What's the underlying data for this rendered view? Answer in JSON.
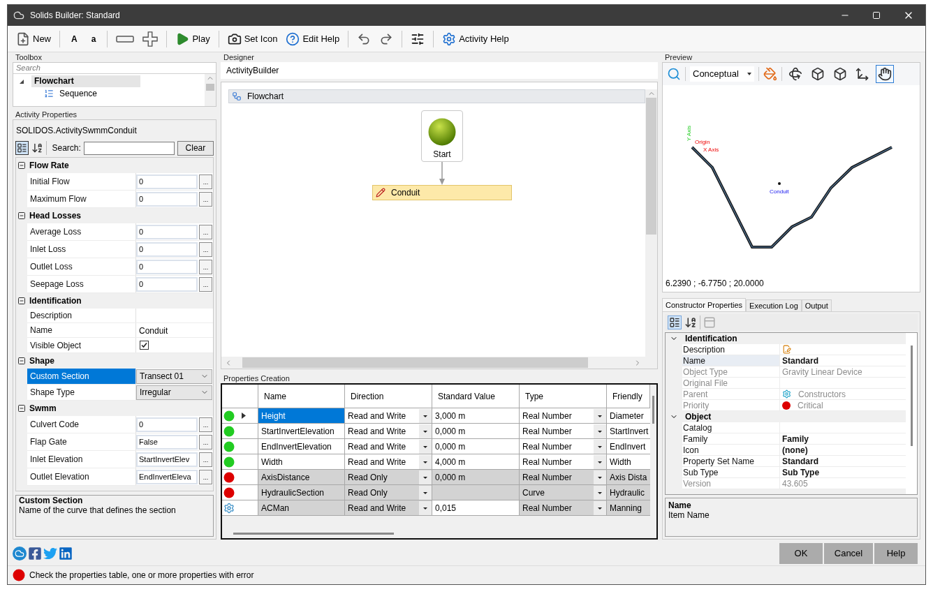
{
  "window": {
    "title": "Solids Builder: Standard"
  },
  "toolbar": [
    {
      "kind": "button",
      "label": "New"
    },
    {
      "kind": "separator"
    },
    {
      "kind": "text",
      "label": "A"
    },
    {
      "kind": "text",
      "label": "a"
    },
    {
      "kind": "separator"
    },
    {
      "kind": "button"
    },
    {
      "kind": "button"
    },
    {
      "kind": "separator"
    },
    {
      "kind": "button",
      "label": "Play"
    },
    {
      "kind": "separator"
    },
    {
      "kind": "button",
      "label": "Set Icon"
    },
    {
      "kind": "button",
      "label": "Edit Help"
    },
    {
      "kind": "separator"
    },
    {
      "kind": "button"
    },
    {
      "kind": "button"
    },
    {
      "kind": "separator"
    },
    {
      "kind": "button"
    },
    {
      "kind": "separator"
    },
    {
      "kind": "button",
      "label": "Activity Help"
    }
  ],
  "toolbox": {
    "title": "Toolbox",
    "search": {
      "placeholder": "Search"
    },
    "tree": [
      {
        "label": "Flowchart",
        "expanded": true,
        "selected": true,
        "children": [
          {
            "label": "Sequence",
            "selected": false
          }
        ]
      }
    ]
  },
  "activity_properties": {
    "title": "Activity Properties",
    "object": "SOLIDOS.ActivitySwmmConduit",
    "search_label": "Search:",
    "clear_button": "Clear",
    "groups": [
      {
        "title": "Flow Rate",
        "expanded": true,
        "rows": [
          {
            "label": "Initial Flow",
            "kind": "field",
            "value": "0",
            "button": "...",
            "selected": false
          },
          {
            "label": "Maximum Flow",
            "kind": "field",
            "value": "0",
            "button": "...",
            "selected": false
          }
        ]
      },
      {
        "title": "Head Losses",
        "expanded": true,
        "rows": [
          {
            "label": "Average Loss",
            "kind": "field",
            "value": "0",
            "button": "...",
            "selected": false
          },
          {
            "label": "Inlet Loss",
            "kind": "field",
            "value": "0",
            "button": "...",
            "selected": false
          },
          {
            "label": "Outlet Loss",
            "kind": "field",
            "value": "0",
            "button": "...",
            "selected": false
          },
          {
            "label": "Seepage Loss",
            "kind": "field",
            "value": "0",
            "button": "...",
            "selected": false
          }
        ]
      },
      {
        "title": "Identification",
        "expanded": true,
        "rows": [
          {
            "label": "Description",
            "kind": "text",
            "selected": false
          },
          {
            "label": "Name",
            "kind": "text",
            "value": "Conduit",
            "selected": false
          },
          {
            "label": "Visible Object",
            "kind": "checkbox",
            "checked": true,
            "selected": false
          }
        ]
      },
      {
        "title": "Shape",
        "expanded": true,
        "rows": [
          {
            "label": "Custom Section",
            "kind": "dropdown",
            "value": "Transect 01",
            "selected": true
          },
          {
            "label": "Shape Type",
            "kind": "dropdown",
            "value": "Irregular",
            "selected": false
          }
        ]
      },
      {
        "title": "Swmm",
        "expanded": true,
        "rows": [
          {
            "label": "Culvert Code",
            "kind": "field",
            "value": "0",
            "button": "...",
            "selected": false
          },
          {
            "label": "Flap Gate",
            "kind": "field",
            "value": "False",
            "button": "...",
            "selected": false
          },
          {
            "label": "Inlet Elevation",
            "kind": "field",
            "value": "StartInvertElev",
            "button": "...",
            "selected": false
          },
          {
            "label": "Outlet Elevation",
            "kind": "field",
            "value": "EndInvertEleva",
            "button": "...",
            "selected": false
          }
        ]
      }
    ],
    "description": {
      "title": "Custom Section",
      "text": "Name of the curve that defines the section"
    }
  },
  "designer": {
    "title": "Designer",
    "breadcrumb": "ActivityBuilder",
    "flowchart": {
      "title": "Flowchart",
      "start": "Start",
      "activity": "Conduit"
    }
  },
  "properties_creation": {
    "title": "Properties Creation",
    "columns": [
      "Name",
      "Direction",
      "Standard Value",
      "Type",
      "Friendly"
    ],
    "rows": [
      {
        "kind": "dot",
        "color": "#22cc22",
        "current": true,
        "selected": true,
        "locked": false,
        "value_locked": false,
        "name": "Height",
        "direction": "Read and Write",
        "value": "3,000 m",
        "type": "Real Number",
        "friendly": "Diameter"
      },
      {
        "kind": "dot",
        "color": "#22cc22",
        "current": false,
        "selected": false,
        "locked": false,
        "value_locked": false,
        "name": "StartInvertElevation",
        "direction": "Read and Write",
        "value": "0,000 m",
        "type": "Real Number",
        "friendly": "StartInvert"
      },
      {
        "kind": "dot",
        "color": "#22cc22",
        "current": false,
        "selected": false,
        "locked": false,
        "value_locked": false,
        "name": "EndInvertElevation",
        "direction": "Read and Write",
        "value": "0,000 m",
        "type": "Real Number",
        "friendly": "EndInvert"
      },
      {
        "kind": "dot",
        "color": "#22cc22",
        "current": false,
        "selected": false,
        "locked": false,
        "value_locked": false,
        "name": "Width",
        "direction": "Read and Write",
        "value": "4,000 m",
        "type": "Real Number",
        "friendly": "Width"
      },
      {
        "kind": "dot",
        "color": "#dd0000",
        "current": false,
        "selected": false,
        "locked": true,
        "value_locked": true,
        "name": "AxisDistance",
        "direction": "Read Only",
        "value": "0,000 m",
        "type": "Real Number",
        "friendly": "Axis Dista"
      },
      {
        "kind": "dot",
        "color": "#dd0000",
        "current": false,
        "selected": false,
        "locked": true,
        "value_locked": true,
        "name": "HydraulicSection",
        "direction": "Read Only",
        "type": "Curve",
        "friendly": "Hydraulic"
      },
      {
        "kind": "gear",
        "current": false,
        "selected": false,
        "locked": true,
        "value_locked": false,
        "name": "ACMan",
        "direction": "Read and Write",
        "value": "0,015",
        "type": "Real Number",
        "friendly": "Manning"
      }
    ]
  },
  "preview": {
    "title": "Preview",
    "view_mode": "Conceptual",
    "tools": [
      {
        "selected": false
      },
      {
        "selected": false
      },
      {
        "selected": false
      },
      {
        "selected": false
      },
      {
        "selected": true
      }
    ],
    "labels": {
      "y_axis": "Y Axis",
      "origin": "Origin",
      "x_axis": "X Axis",
      "object": "Conduit"
    },
    "coordinates": "6.2390 ; -6.7750 ; 20.0000"
  },
  "constructor_panel": {
    "tabs": [
      {
        "label": "Constructor Properties",
        "selected": true
      },
      {
        "label": "Execution Log",
        "selected": false
      },
      {
        "label": "Output",
        "selected": false
      }
    ],
    "groups": [
      {
        "title": "Identification",
        "expanded": true,
        "rows": [
          {
            "kind": "edit",
            "label": "Description",
            "disabled": false,
            "selected": false
          },
          {
            "kind": "text",
            "label": "Name",
            "value": "Standard",
            "bold": true,
            "disabled": false,
            "selected": true
          },
          {
            "kind": "text",
            "label": "Object Type",
            "value": "Gravity Linear Device",
            "bold": false,
            "disabled": true,
            "selected": false
          },
          {
            "kind": "text",
            "label": "Original File",
            "disabled": true,
            "selected": false
          },
          {
            "kind": "link",
            "label": "Parent",
            "value": "Constructors",
            "bold": false,
            "disabled": true,
            "selected": false
          },
          {
            "kind": "priority",
            "label": "Priority",
            "value": "Critical",
            "bold": false,
            "disabled": true,
            "selected": false
          }
        ]
      },
      {
        "title": "Object",
        "expanded": true,
        "rows": [
          {
            "kind": "text",
            "label": "Catalog",
            "disabled": false,
            "selected": false
          },
          {
            "kind": "text",
            "label": "Family",
            "value": "Family",
            "bold": true,
            "disabled": false,
            "selected": false
          },
          {
            "kind": "text",
            "label": "Icon",
            "value": "(none)",
            "bold": true,
            "disabled": false,
            "selected": false
          },
          {
            "kind": "text",
            "label": "Property Set Name",
            "value": "Standard",
            "bold": true,
            "disabled": false,
            "selected": false
          },
          {
            "kind": "text",
            "label": "Sub Type",
            "value": "Sub Type",
            "bold": true,
            "disabled": false,
            "selected": false
          },
          {
            "kind": "text",
            "label": "Version",
            "value": "43.605",
            "bold": false,
            "disabled": true,
            "selected": false
          }
        ]
      }
    ],
    "description": {
      "title": "Name",
      "text": "Item Name"
    }
  },
  "buttons": [
    "OK",
    "Cancel",
    "Help"
  ],
  "status": {
    "message": "Check the properties table, one or more properties with error"
  }
}
